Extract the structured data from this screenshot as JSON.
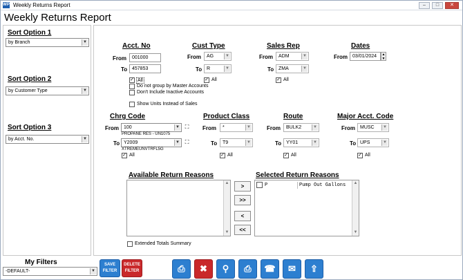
{
  "window": {
    "title": "Weekly Returns Report",
    "icon_text": "WP"
  },
  "header": {
    "title": "Weekly Returns Report"
  },
  "sort": {
    "opt1_label": "Sort Option 1",
    "opt1_value": "by Branch",
    "opt2_label": "Sort Option 2",
    "opt2_value": "by Customer Type",
    "opt3_label": "Sort Option 3",
    "opt3_value": "by Acct. No."
  },
  "acct": {
    "title": "Acct. No",
    "from_label": "From",
    "from": "001000",
    "to_label": "To",
    "to": "457853",
    "all": "All",
    "no_group": "Do not group by Master Accounts",
    "no_inactive": "Don't Include Inactive Accounts"
  },
  "show_units": "Show Units Instead of Sales",
  "cust": {
    "title": "Cust Type",
    "from_label": "From",
    "from": "AG",
    "to_label": "To",
    "to": "R",
    "all": "All"
  },
  "rep": {
    "title": "Sales Rep",
    "from_label": "From",
    "from": "ADM",
    "to_label": "To",
    "to": "ZMA",
    "all": "All"
  },
  "dates": {
    "title": "Dates",
    "from_label": "From",
    "from": "03/01/2024"
  },
  "chrg": {
    "title": "Chrg Code",
    "from_label": "From",
    "from": "100",
    "from_desc": "PROPANE RES - UN1075",
    "to_label": "To",
    "to": "Y2009",
    "to_desc": "XTREMEUNVTRFL5G",
    "all": "All"
  },
  "prodclass": {
    "title": "Product Class",
    "from_label": "From",
    "from": "*",
    "to_label": "To",
    "to": "T9",
    "all": "All"
  },
  "route": {
    "title": "Route",
    "from_label": "From",
    "from": "BULK2",
    "to_label": "To",
    "to": "YY01",
    "all": "All"
  },
  "major": {
    "title": "Major Acct. Code",
    "from_label": "From",
    "from": "MUSC",
    "to_label": "To",
    "to": "UPS",
    "all": "All"
  },
  "reasons": {
    "available_title": "Available Return Reasons",
    "selected_title": "Selected Return Reasons",
    "selected_items": [
      {
        "code": "P",
        "desc": "Pump Out Gallons"
      }
    ],
    "btn_add": ">",
    "btn_add_all": ">>",
    "btn_remove": "<",
    "btn_remove_all": "<<"
  },
  "extended": "Extended Totals Summary",
  "filters": {
    "title": "My Filters",
    "value": "-DEFAULT-",
    "save": "SAVE FILTER",
    "delete": "DELETE FILTER"
  },
  "colors": {
    "blue_button": "#2d7fd0",
    "red_button": "#c9282a"
  },
  "toolbar_icons": [
    "print-icon",
    "close-icon",
    "search-icon",
    "print-preview-icon",
    "fax-icon",
    "email-icon",
    "export-icon"
  ]
}
